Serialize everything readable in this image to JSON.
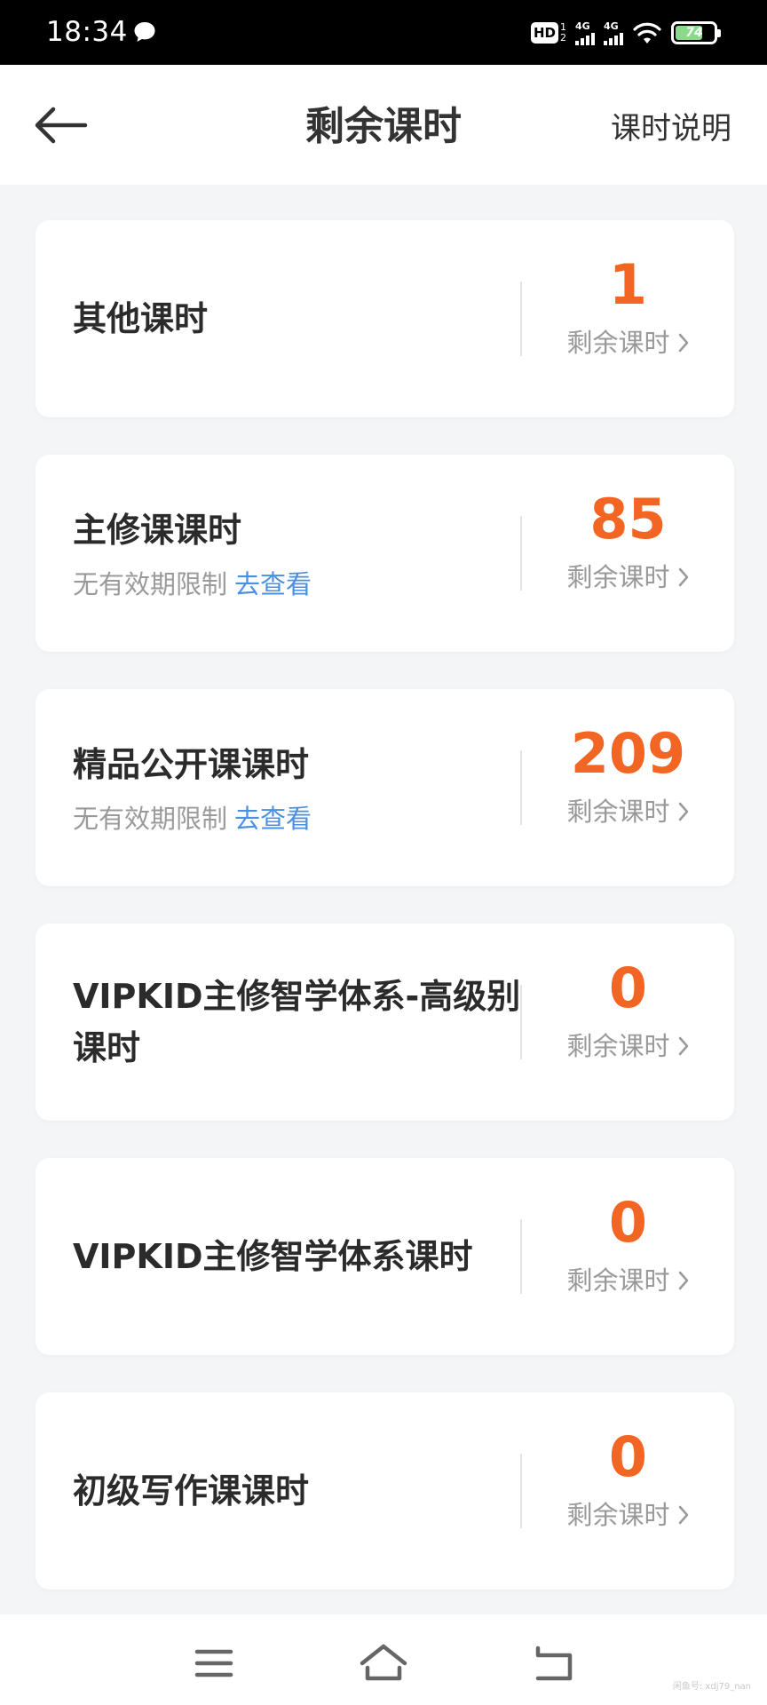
{
  "status_bar": {
    "time": "18:34",
    "hd_label": "HD",
    "hd_top": "1",
    "hd_bottom": "2",
    "signal1_label": "4G",
    "signal2_label": "4G",
    "battery_level": "74"
  },
  "header": {
    "title": "剩余课时",
    "help_label": "课时说明"
  },
  "cards": [
    {
      "title": "其他课时",
      "subtitle": "",
      "link": "",
      "count": "1",
      "count_label": "剩余课时"
    },
    {
      "title": "主修课课时",
      "subtitle": "无有效期限制",
      "link": "去查看",
      "count": "85",
      "count_label": "剩余课时"
    },
    {
      "title": "精品公开课课时",
      "subtitle": "无有效期限制",
      "link": "去查看",
      "count": "209",
      "count_label": "剩余课时"
    },
    {
      "title": "VIPKID主修智学体系-高级别课时",
      "subtitle": "",
      "link": "",
      "count": "0",
      "count_label": "剩余课时"
    },
    {
      "title": "VIPKID主修智学体系课时",
      "subtitle": "",
      "link": "",
      "count": "0",
      "count_label": "剩余课时"
    },
    {
      "title": "初级写作课课时",
      "subtitle": "",
      "link": "",
      "count": "0",
      "count_label": "剩余课时"
    }
  ],
  "colors": {
    "accent_orange": "#f26522",
    "link_blue": "#4a90e2",
    "page_bg": "#f4f5f7"
  },
  "nav": {
    "watermark": "闲鱼号: xdj79_nan"
  }
}
